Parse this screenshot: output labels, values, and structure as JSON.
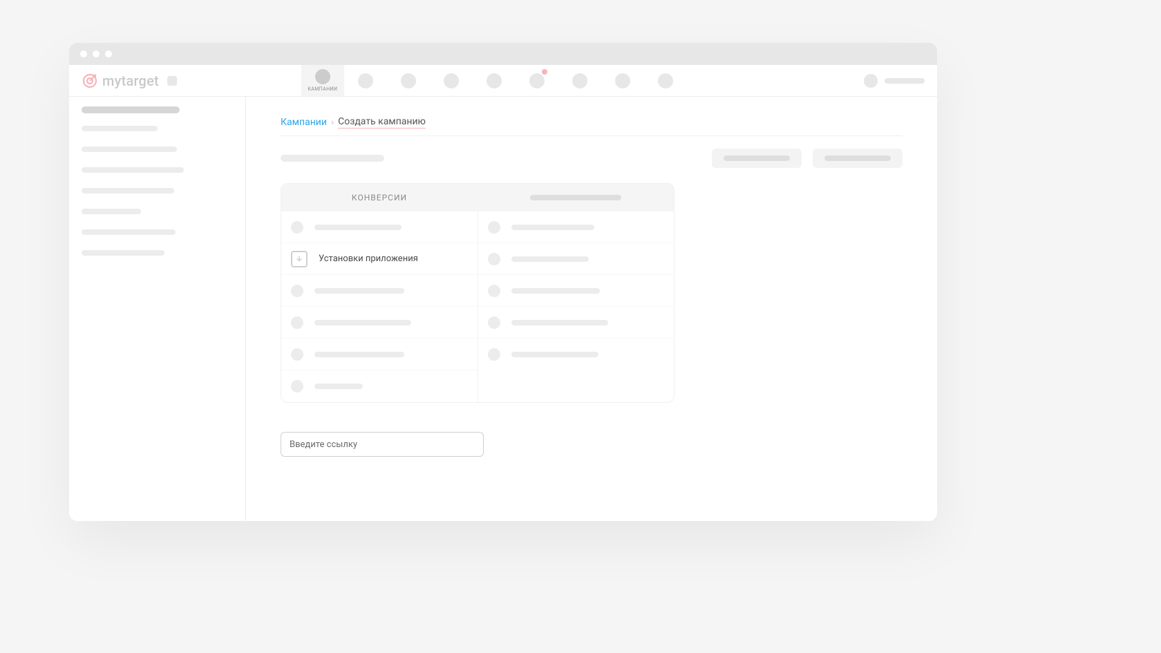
{
  "logo_text": "mytarget",
  "topnav": {
    "active_label": "КАМПАНИИ",
    "notif_index": 5
  },
  "breadcrumbs": {
    "root": "Кампании",
    "sep": "›",
    "current": "Создать кампанию"
  },
  "goals": {
    "tab_left": "Конверсии",
    "highlighted_label": "Установки приложения"
  },
  "link_input_placeholder": "Введите ссылку",
  "sidebar_widths": [
    142,
    110,
    138,
    148,
    134,
    86,
    136,
    120
  ],
  "left_goal_bar_widths": [
    126,
    0,
    130,
    140,
    130,
    70
  ],
  "right_goal_bar_widths": [
    120,
    112,
    128,
    140,
    126
  ]
}
